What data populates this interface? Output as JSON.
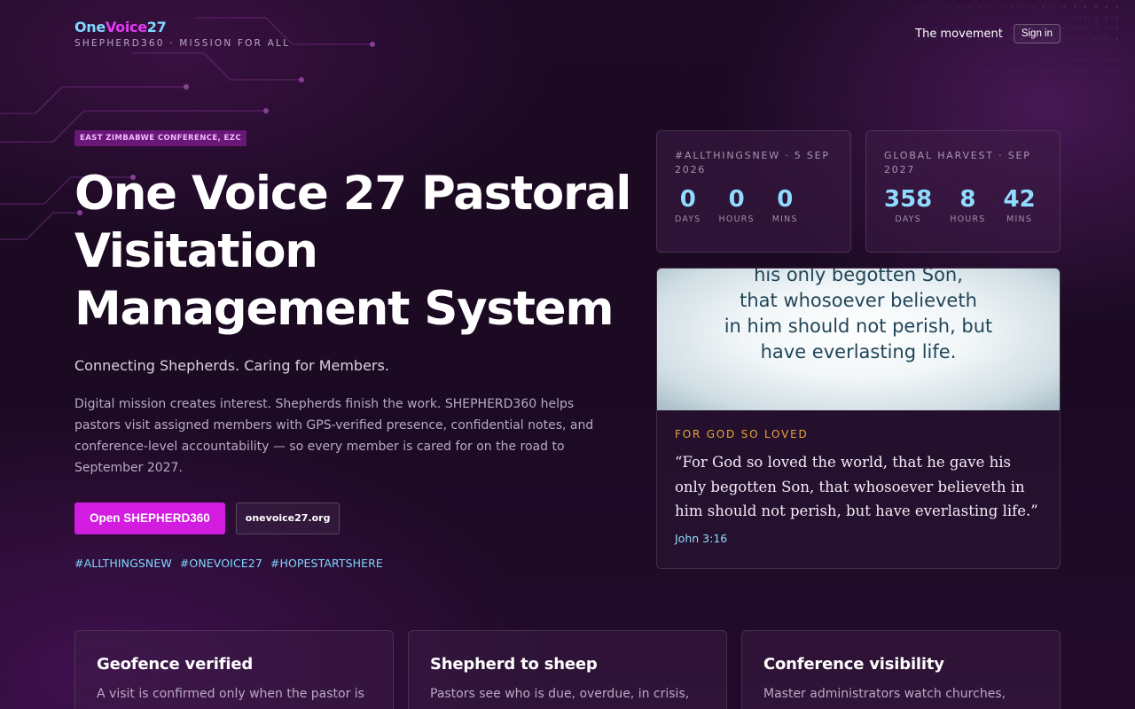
{
  "header": {
    "logo": {
      "one": "One",
      "voice": "Voice",
      "num": "27"
    },
    "tagline": "SHEPHERD360 · MISSION FOR ALL",
    "nav_link": "The movement",
    "signin_label": "Sign in"
  },
  "hero": {
    "badge": "EAST ZIMBABWE CONFERENCE, EZC",
    "title": "One Voice 27 Pastoral Visitation Management System",
    "subtitle": "Connecting Shepherds. Caring for Members.",
    "description": "Digital mission creates interest. Shepherds finish the work. SHEPHERD360 helps pastors visit assigned members with GPS-verified presence, confidential notes, and conference-level accountability — so every member is cared for on the road to September 2027.",
    "primary_button": "Open SHEPHERD360",
    "secondary_button": "onevoice27.org",
    "hashtags": [
      "#ALLTHINGSNEW",
      "#ONEVOICE27",
      "#HOPESTARTSHERE"
    ]
  },
  "countdowns": [
    {
      "label": "#ALLTHINGSNEW · 5 SEP 2026",
      "units": [
        {
          "value": "0",
          "label": "DAYS"
        },
        {
          "value": "0",
          "label": "HOURS"
        },
        {
          "value": "0",
          "label": "MINS"
        }
      ]
    },
    {
      "label": "GLOBAL HARVEST · SEP 2027",
      "units": [
        {
          "value": "358",
          "label": "DAYS"
        },
        {
          "value": "8",
          "label": "HOURS"
        },
        {
          "value": "42",
          "label": "MINS"
        }
      ]
    }
  ],
  "verse": {
    "image_lines": [
      "his only begotten Son,",
      "that whosoever believeth",
      "in him should not perish, but",
      "have everlasting life."
    ],
    "kicker": "FOR GOD SO LOVED",
    "quote": "“For God so loved the world, that he gave his only begotten Son, that whosoever believeth in him should not perish, but have everlasting life.”",
    "reference": "John 3:16"
  },
  "features": [
    {
      "title": "Geofence verified",
      "text": "A visit is confirmed only when the pastor is"
    },
    {
      "title": "Shepherd to sheep",
      "text": "Pastors see who is due, overdue, in crisis,"
    },
    {
      "title": "Conference visibility",
      "text": "Master administrators watch churches,"
    }
  ],
  "colors": {
    "accent_magenta": "#d21cdf",
    "accent_cyan": "#8fdcff",
    "accent_gold": "#e7a53b",
    "background": "#1d0a25"
  }
}
